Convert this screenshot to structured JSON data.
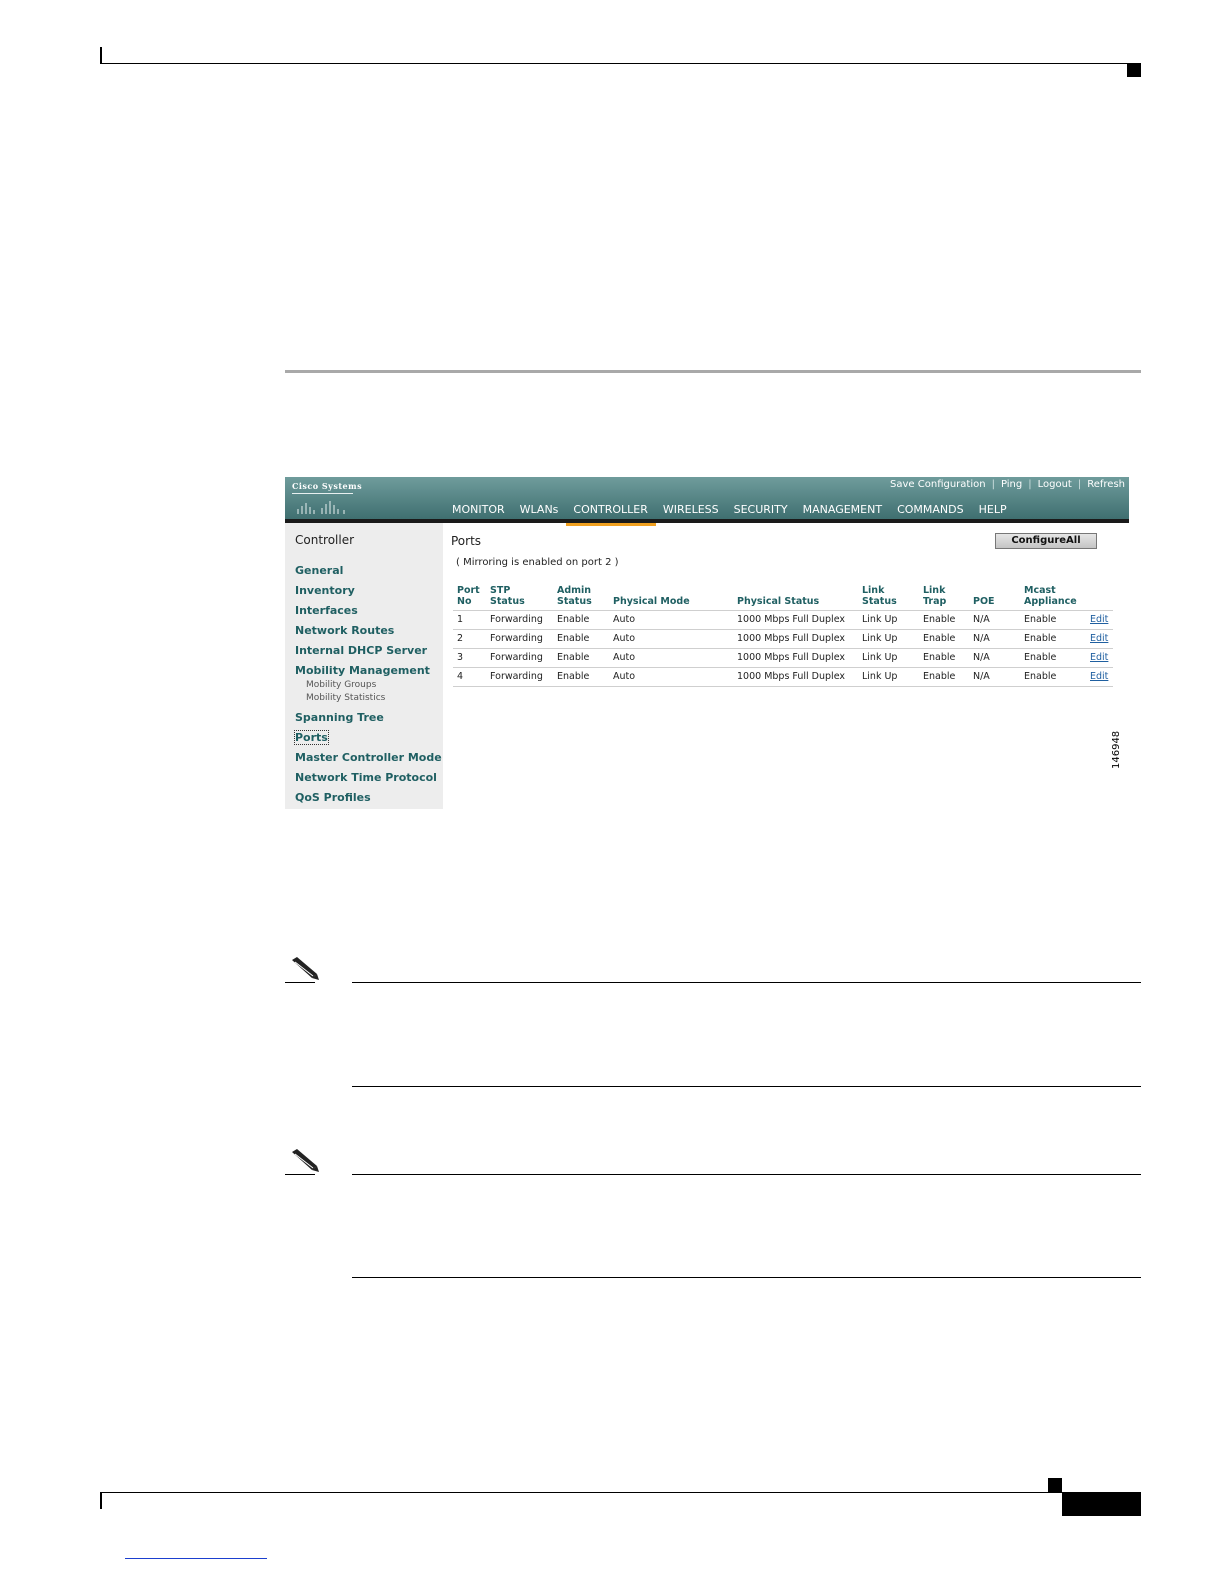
{
  "app": {
    "logo_text": "Cisco Systems",
    "top_links": [
      "Save Configuration",
      "Ping",
      "Logout",
      "Refresh"
    ],
    "nav_tabs": [
      {
        "label": "MONITOR",
        "active": false
      },
      {
        "label": "WLANs",
        "active": false
      },
      {
        "label": "CONTROLLER",
        "active": true
      },
      {
        "label": "WIRELESS",
        "active": false
      },
      {
        "label": "SECURITY",
        "active": false
      },
      {
        "label": "MANAGEMENT",
        "active": false
      },
      {
        "label": "COMMANDS",
        "active": false
      },
      {
        "label": "HELP",
        "active": false
      }
    ],
    "accent_color": "#f0a020",
    "bar_color": "#4f7f80"
  },
  "sidebar": {
    "title": "Controller",
    "items": [
      {
        "label": "General"
      },
      {
        "label": "Inventory"
      },
      {
        "label": "Interfaces"
      },
      {
        "label": "Network Routes"
      },
      {
        "label": "Internal DHCP Server"
      },
      {
        "label": "Mobility Management"
      },
      {
        "label": "Mobility Groups"
      },
      {
        "label": "Mobility Statistics"
      },
      {
        "label": "Spanning Tree"
      },
      {
        "label": "Ports"
      },
      {
        "label": "Master Controller Mode"
      },
      {
        "label": "Network Time Protocol"
      },
      {
        "label": "QoS Profiles"
      }
    ],
    "selected": "Ports"
  },
  "main": {
    "title": "Ports",
    "configure_all_label": "ConfigureAll",
    "mirroring_note": "( Mirroring is enabled on port 2 )",
    "table": {
      "headers": [
        "Port No",
        "STP Status",
        "Admin Status",
        "Physical Mode",
        "Physical Status",
        "Link Status",
        "Link Trap",
        "POE",
        "Mcast Appliance",
        ""
      ],
      "rows": [
        [
          "1",
          "Forwarding",
          "Enable",
          "Auto",
          "1000 Mbps Full Duplex",
          "Link Up",
          "Enable",
          "N/A",
          "Enable",
          "Edit"
        ],
        [
          "2",
          "Forwarding",
          "Enable",
          "Auto",
          "1000 Mbps Full Duplex",
          "Link Up",
          "Enable",
          "N/A",
          "Enable",
          "Edit"
        ],
        [
          "3",
          "Forwarding",
          "Enable",
          "Auto",
          "1000 Mbps Full Duplex",
          "Link Up",
          "Enable",
          "N/A",
          "Enable",
          "Edit"
        ],
        [
          "4",
          "Forwarding",
          "Enable",
          "Auto",
          "1000 Mbps Full Duplex",
          "Link Up",
          "Enable",
          "N/A",
          "Enable",
          "Edit"
        ]
      ]
    }
  },
  "figure_id": "146948"
}
